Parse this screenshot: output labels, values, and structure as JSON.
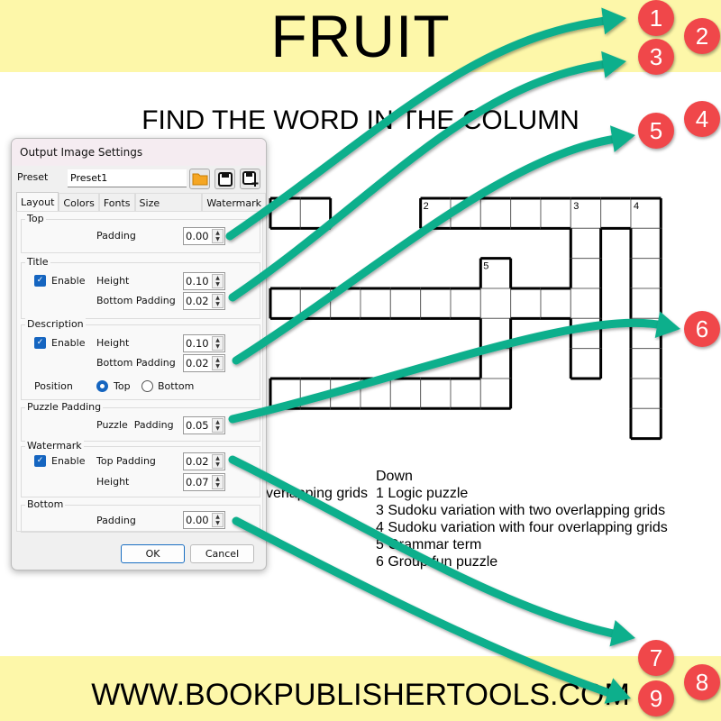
{
  "page": {
    "title": "FRUIT",
    "subtitle": "FIND THE WORD IN THE COLUMN",
    "footer": "WWW.BOOKPUBLISHERTOOLS.COM"
  },
  "colors": {
    "band": "#fdf7a9",
    "arrow": "#0aaf8c",
    "badge": "#f0474a",
    "accent": "#1565c0"
  },
  "puzzle": {
    "numbers": [
      "2",
      "3",
      "4",
      "5"
    ],
    "clues": {
      "across_fragment": "overlapping grids",
      "down_heading": "Down",
      "down": [
        "1 Logic puzzle",
        "3 Sudoku variation with two overlapping grids",
        "4 Sudoku variation with four overlapping grids",
        "5 Grammar term",
        "6 Group fun puzzle"
      ]
    }
  },
  "dialog": {
    "title": "Output Image Settings",
    "preset_label": "Preset",
    "preset_value": "Preset1",
    "toolbar_icons": [
      "folder-open-icon",
      "save-icon",
      "save-as-icon"
    ],
    "tabs": [
      "Layout",
      "Colors",
      "Fonts",
      "Size Options",
      "Watermark"
    ],
    "active_tab": "Layout",
    "top": {
      "label": "Top",
      "padding_label": "Padding",
      "padding": "0.00"
    },
    "title_group": {
      "label": "Title",
      "enable_label": "Enable",
      "enabled": true,
      "height_label": "Height",
      "height": "0.10",
      "bottom_padding_label": "Bottom Padding",
      "bottom_padding": "0.02"
    },
    "description": {
      "label": "Description",
      "enable_label": "Enable",
      "enabled": true,
      "height_label": "Height",
      "height": "0.10",
      "bottom_padding_label": "Bottom Padding",
      "bottom_padding": "0.02",
      "position_label": "Position",
      "position_options": [
        "Top",
        "Bottom"
      ],
      "position": "Top"
    },
    "puzzle_padding": {
      "label": "Puzzle Padding",
      "padding_label": "Puzzle  Padding",
      "padding": "0.05"
    },
    "watermark": {
      "label": "Watermark",
      "enable_label": "Enable",
      "enabled": true,
      "top_padding_label": "Top Padding",
      "top_padding": "0.02",
      "height_label": "Height",
      "height": "0.07"
    },
    "bottom": {
      "label": "Bottom",
      "padding_label": "Padding",
      "padding": "0.00"
    },
    "ok": "OK",
    "cancel": "Cancel"
  },
  "badges": [
    "1",
    "2",
    "3",
    "4",
    "5",
    "6",
    "7",
    "8",
    "9"
  ]
}
